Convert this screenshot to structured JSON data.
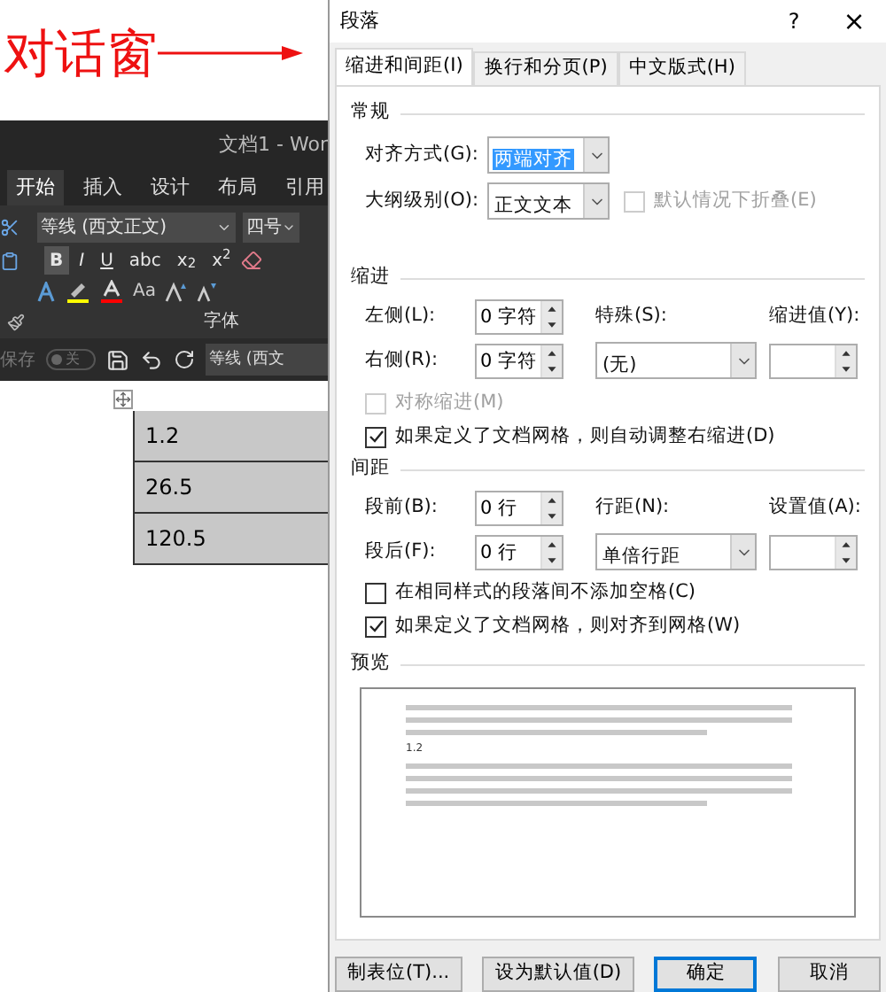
{
  "annotation": {
    "label": "对话窗"
  },
  "word": {
    "title": "文档1 - Wor",
    "tabs": [
      {
        "label": "开始",
        "selected": true
      },
      {
        "label": "插入",
        "selected": false
      },
      {
        "label": "设计",
        "selected": false
      },
      {
        "label": "布局",
        "selected": false
      },
      {
        "label": "引用",
        "selected": false
      }
    ],
    "font_name": "等线 (西文正文)",
    "font_size": "四号",
    "format_buttons": [
      {
        "label": "B",
        "selected": true
      },
      {
        "label": "I",
        "selected": false
      },
      {
        "label": "U",
        "selected": false
      },
      {
        "label": "abc",
        "selected": false
      },
      {
        "label": "x$_{2}$",
        "selected": false
      },
      {
        "label": "x$^{2}$",
        "selected": false
      }
    ],
    "case_button": "Aa",
    "group_label": "字体",
    "autosave": "保存",
    "autosave_toggle": {
      "label": "关",
      "on": false
    },
    "quick_font": "等线 (西文",
    "table_rows": [
      "1.2",
      "26.5",
      "120.5"
    ]
  },
  "dialog": {
    "title": "段落",
    "help": "?",
    "close": "×",
    "tabs": [
      {
        "label": "缩进和间距(I)",
        "selected": true
      },
      {
        "label": "换行和分页(P)",
        "selected": false
      },
      {
        "label": "中文版式(H)",
        "selected": false
      }
    ],
    "general": {
      "heading": "常规",
      "alignment": {
        "label": "对齐方式(G):",
        "value": "两端对齐"
      },
      "outline": {
        "label": "大纲级别(O):",
        "value": "正文文本"
      },
      "collapse": {
        "label": "默认情况下折叠(E)",
        "checked": false,
        "disabled": true
      }
    },
    "indent": {
      "heading": "缩进",
      "left": {
        "label": "左侧(L):",
        "value": "0 字符"
      },
      "right": {
        "label": "右侧(R):",
        "value": "0 字符"
      },
      "special": {
        "label": "特殊(S):",
        "value": "(无)"
      },
      "by": {
        "label": "缩进值(Y):"
      },
      "mirror": {
        "label": "对称缩进(M)",
        "checked": false,
        "disabled": true
      },
      "auto_adjust": {
        "label": "如果定义了文档网格，则自动调整右缩进(D)",
        "checked": true,
        "disabled": false
      }
    },
    "spacing": {
      "heading": "间距",
      "before": {
        "label": "段前(B):",
        "value": "0 行"
      },
      "after": {
        "label": "段后(F):",
        "value": "0 行"
      },
      "line_spacing": {
        "label": "行距(N):",
        "value": "单倍行距"
      },
      "at": {
        "label": "设置值(A):"
      },
      "no_space": {
        "label": "在相同样式的段落间不添加空格(C)",
        "checked": false,
        "disabled": false
      },
      "snap": {
        "label": "如果定义了文档网格，则对齐到网格(W)",
        "checked": true,
        "disabled": false
      }
    },
    "preview": {
      "heading": "预览",
      "sample": "1.2"
    },
    "buttons": [
      {
        "label": "制表位(T)...",
        "default": false
      },
      {
        "label": "设为默认值(D)",
        "default": false
      },
      {
        "label": "确定",
        "default": true
      },
      {
        "label": "取消",
        "default": false
      }
    ]
  }
}
